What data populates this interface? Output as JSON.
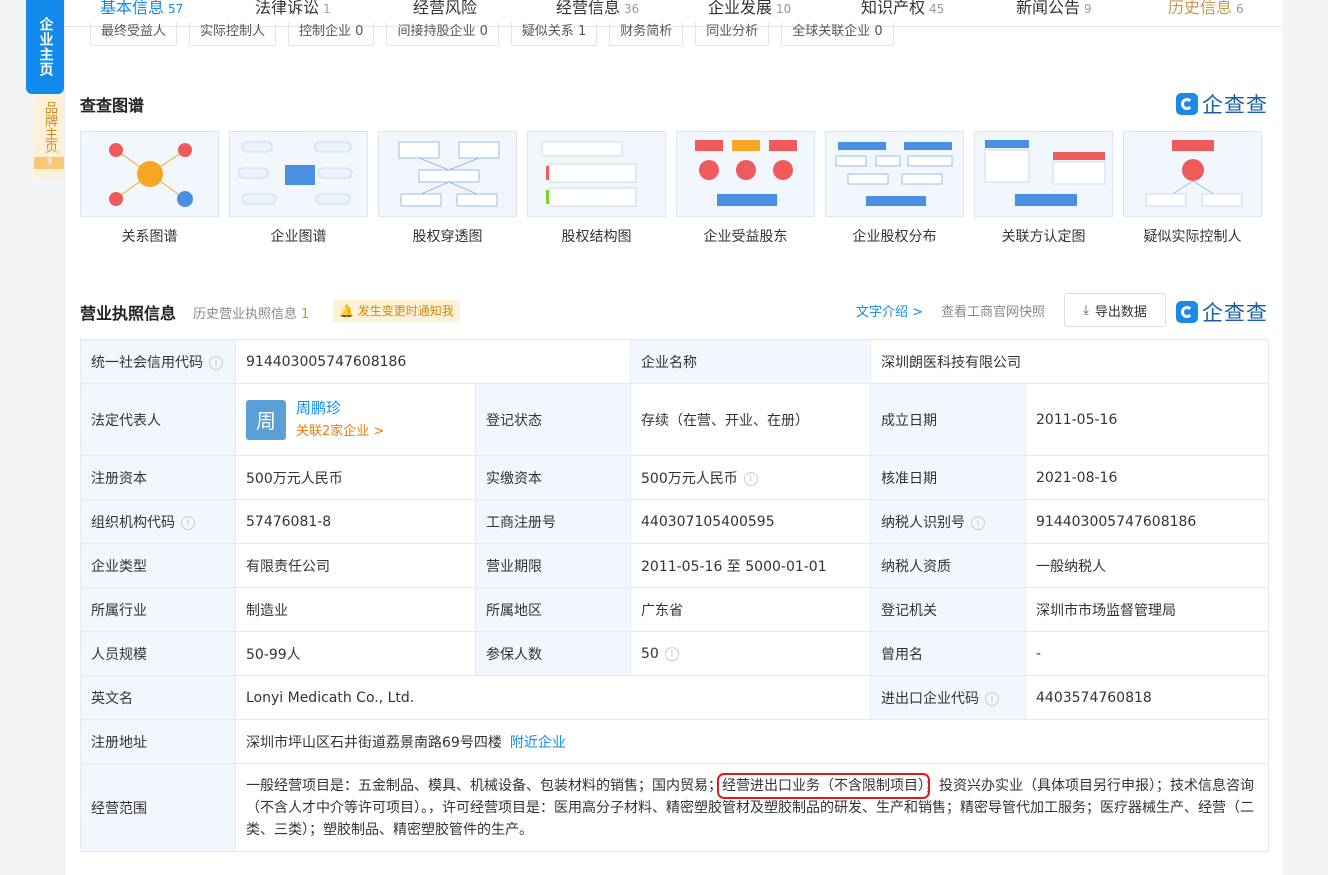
{
  "side": {
    "main_tab": "企业主页",
    "brand_tab": "品牌主页",
    "brand_count": "3"
  },
  "tabs": [
    {
      "label": "基本信息",
      "count": "57"
    },
    {
      "label": "法律诉讼",
      "count": "1"
    },
    {
      "label": "经营风险",
      "count": ""
    },
    {
      "label": "经营信息",
      "count": "36"
    },
    {
      "label": "企业发展",
      "count": "10"
    },
    {
      "label": "知识产权",
      "count": "45"
    },
    {
      "label": "新闻公告",
      "count": "9"
    },
    {
      "label": "历史信息",
      "count": "6"
    }
  ],
  "chips": [
    "最终受益人",
    "实际控制人",
    "控制企业 0",
    "间接持股企业 0",
    "疑似关系 1",
    "财务简析",
    "同业分析",
    "全球关联企业 0"
  ],
  "graph": {
    "title": "查查图谱",
    "logo_text": "企查查",
    "cards": [
      "关系图谱",
      "企业图谱",
      "股权穿透图",
      "股权结构图",
      "企业受益股东",
      "企业股权分布",
      "关联方认定图",
      "疑似实际控制人"
    ]
  },
  "license": {
    "title": "营业执照信息",
    "history_label": "历史营业执照信息",
    "history_count": "1",
    "notify": "发生变更时通知我",
    "intro_link": "文字介绍 >",
    "snapshot": "查看工商官网快照",
    "export": "导出数据",
    "logo_text": "企查查"
  },
  "table": {
    "credit_code_label": "统一社会信用代码",
    "credit_code": "914403005747608186",
    "company_name_label": "企业名称",
    "company_name": "深圳朗医科技有限公司",
    "legal_rep_label": "法定代表人",
    "legal_rep_avatar": "周",
    "legal_rep_name": "周鹏珍",
    "legal_rep_related": "关联2家企业 >",
    "reg_status_label": "登记状态",
    "reg_status": "存续（在营、开业、在册）",
    "found_date_label": "成立日期",
    "found_date": "2011-05-16",
    "reg_capital_label": "注册资本",
    "reg_capital": "500万元人民币",
    "paid_capital_label": "实缴资本",
    "paid_capital": "500万元人民币",
    "approve_date_label": "核准日期",
    "approve_date": "2021-08-16",
    "org_code_label": "组织机构代码",
    "org_code": "57476081-8",
    "biz_reg_no_label": "工商注册号",
    "biz_reg_no": "440307105400595",
    "taxpayer_id_label": "纳税人识别号",
    "taxpayer_id": "914403005747608186",
    "company_type_label": "企业类型",
    "company_type": "有限责任公司",
    "biz_term_label": "营业期限",
    "biz_term": "2011-05-16 至 5000-01-01",
    "taxpayer_qual_label": "纳税人资质",
    "taxpayer_qual": "一般纳税人",
    "industry_label": "所属行业",
    "industry": "制造业",
    "region_label": "所属地区",
    "region": "广东省",
    "reg_authority_label": "登记机关",
    "reg_authority": "深圳市市场监督管理局",
    "staff_label": "人员规模",
    "staff": "50-99人",
    "insured_label": "参保人数",
    "insured": "50",
    "former_name_label": "曾用名",
    "former_name": "-",
    "english_name_label": "英文名",
    "english_name": "Lonyi Medicath Co., Ltd.",
    "ie_code_label": "进出口企业代码",
    "ie_code": "4403574760818",
    "address_label": "注册地址",
    "address": "深圳市坪山区石井街道荔景南路69号四楼",
    "nearby_link": "附近企业",
    "scope_label": "经营范围",
    "scope_part1": "一般经营项目是：五金制品、模具、机械设备、包装材料的销售；国内贸易；",
    "scope_highlight": "经营进出口业务（不含限制项目）",
    "scope_part2": "；投资兴办实业（具体项目另行申报）；技术信息咨询（不含人才中介等许可项目）。，许可经营项目是：医用高分子材料、精密塑胶管材及塑胶制品的研发、生产和销售；精密导管代加工服务；医疗器械生产、经营（二类、三类）；塑胶制品、精密塑胶管件的生产。"
  }
}
